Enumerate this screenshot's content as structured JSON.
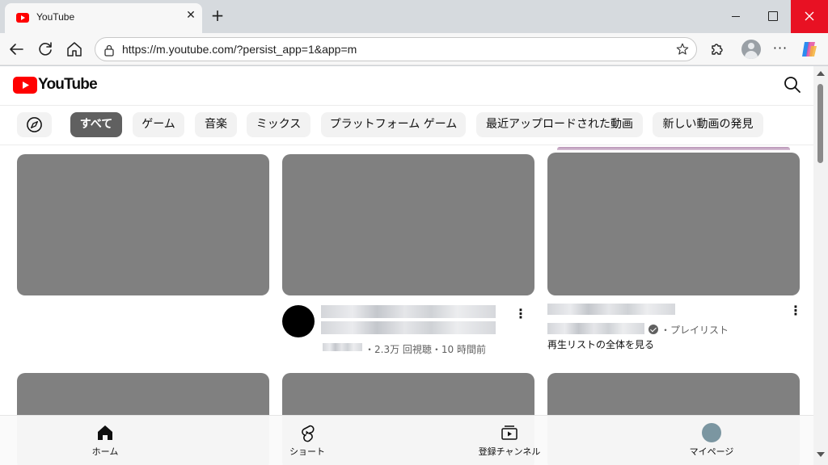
{
  "browser": {
    "tab_title": "YouTube",
    "url": "https://m.youtube.com/?persist_app=1&app=m",
    "tab_close_glyph": "✕",
    "new_tab_glyph": "+",
    "more_glyph": "···"
  },
  "youtube": {
    "logo_text": "YouTube",
    "chips": [
      {
        "label": "すべて",
        "active": true
      },
      {
        "label": "ゲーム"
      },
      {
        "label": "音楽"
      },
      {
        "label": "ミックス"
      },
      {
        "label": "プラットフォーム ゲーム"
      },
      {
        "label": "最近アップロードされた動画"
      },
      {
        "label": "新しい動画の発見"
      }
    ],
    "videos": [
      {
        "meta": "・2.3万 回視聴・10 時間前"
      },
      {
        "meta": "・プレイリスト",
        "playlist_link": "再生リストの全体を見る"
      }
    ],
    "kebab_glyph": "⋮",
    "bottom_nav": [
      {
        "label": "ホーム",
        "icon": "home-icon"
      },
      {
        "label": "ショート",
        "icon": "shorts-icon"
      },
      {
        "label": "登録チャンネル",
        "icon": "subscriptions-icon"
      },
      {
        "label": "マイページ",
        "icon": "avatar"
      }
    ]
  },
  "colors": {
    "brand_red": "#ff0000",
    "close_red": "#e81123",
    "thumb_gray": "#808080",
    "chip_active": "#606060"
  }
}
